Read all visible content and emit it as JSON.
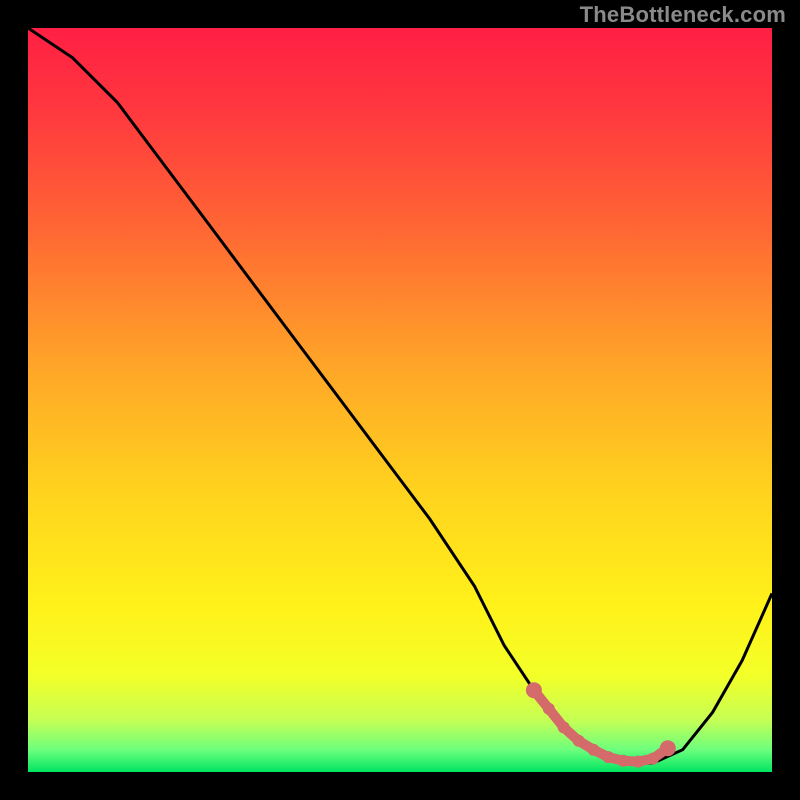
{
  "watermark": "TheBottleneck.com",
  "gradient_stops": [
    {
      "offset": 0.0,
      "color": "#ff1f44"
    },
    {
      "offset": 0.12,
      "color": "#ff3a3e"
    },
    {
      "offset": 0.28,
      "color": "#ff6a33"
    },
    {
      "offset": 0.45,
      "color": "#ffa428"
    },
    {
      "offset": 0.62,
      "color": "#ffd21e"
    },
    {
      "offset": 0.78,
      "color": "#fff21a"
    },
    {
      "offset": 0.87,
      "color": "#f3ff28"
    },
    {
      "offset": 0.93,
      "color": "#c6ff54"
    },
    {
      "offset": 0.97,
      "color": "#6dff7d"
    },
    {
      "offset": 1.0,
      "color": "#00e562"
    }
  ],
  "marker_color": "#d46a6a",
  "chart_data": {
    "type": "line",
    "title": "",
    "xlabel": "",
    "ylabel": "",
    "xlim": [
      0,
      100
    ],
    "ylim": [
      0,
      100
    ],
    "series": [
      {
        "name": "curve",
        "x": [
          0,
          6,
          12,
          18,
          24,
          30,
          36,
          42,
          48,
          54,
          60,
          64,
          68,
          72,
          76,
          80,
          84,
          88,
          92,
          96,
          100
        ],
        "y": [
          100,
          96,
          90,
          82,
          74,
          66,
          58,
          50,
          42,
          34,
          25,
          17,
          11,
          6,
          3,
          1.2,
          1.2,
          3,
          8,
          15,
          24
        ]
      }
    ],
    "markers": {
      "name": "trough-markers",
      "x": [
        68,
        70,
        72,
        74,
        76,
        78,
        80,
        82,
        84,
        86
      ],
      "y": [
        11,
        8.5,
        6,
        4.2,
        3,
        2,
        1.5,
        1.4,
        1.8,
        3.2
      ]
    }
  }
}
